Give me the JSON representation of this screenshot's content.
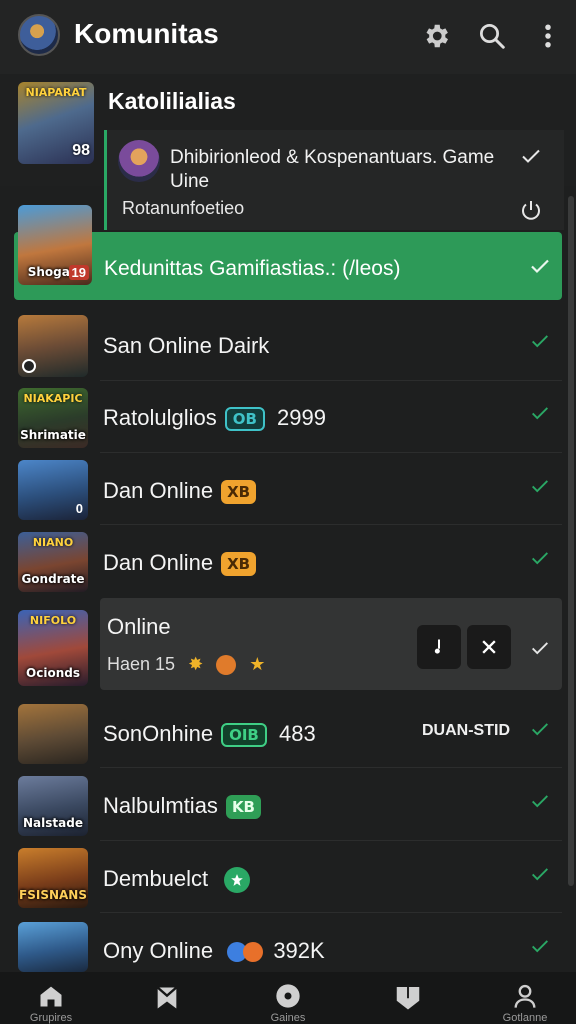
{
  "app": {
    "title": "Komunitas"
  },
  "toolbar": {
    "settings_icon": "gear-icon",
    "search_icon": "search-icon",
    "more_icon": "more-vert-icon"
  },
  "group": {
    "title": "Katolilialias",
    "thumb_top": "NIAPARAT",
    "thumb_badge": "98",
    "sub_item": {
      "title": "Dhibirionleod & Kospenantuars. Game Uine",
      "footer": "Rotanunfoetieo"
    }
  },
  "selected": {
    "title": "Kedunittas Gamifiastias.: (/leos)",
    "thumb_caption": "Shogam",
    "thumb_badge": "19"
  },
  "rows": [
    {
      "name": "San Online  Dairk",
      "thumb_caption": "",
      "badge": ""
    },
    {
      "name": "Ratolulglios",
      "thumb_top": "NIAKAPIC",
      "thumb_caption": "Shrimatie",
      "badge": "OB",
      "extra": "2999"
    },
    {
      "name": "Dan Online",
      "thumb_caption": "0",
      "badge": "XB"
    },
    {
      "name": "Dan Online",
      "thumb_top": "NIANO",
      "thumb_caption": "Gondrate",
      "badge": "XB"
    },
    {
      "name": "Online",
      "thumb_top": "NIFOLO",
      "thumb_caption": "Ocionds",
      "subline": "Haen 15"
    },
    {
      "name": "SonOnhine",
      "badge": "OIB",
      "extra": "483",
      "right_text": "DUAN-STID"
    },
    {
      "name": "Nalbulmtias",
      "thumb_caption": "Nalstade",
      "badge": "KB"
    },
    {
      "name": "Dembuelct",
      "thumb_caption": "FSISNANS"
    },
    {
      "name": "Ony Online",
      "extra": "392K"
    }
  ],
  "bottom_nav": [
    {
      "label": "Grupires",
      "icon": "home-icon"
    },
    {
      "label": "",
      "icon": "bookmark-icon"
    },
    {
      "label": "Gaines",
      "icon": "disc-icon"
    },
    {
      "label": "",
      "icon": "shield-icon"
    },
    {
      "label": "Gotlanne",
      "icon": "profile-icon"
    }
  ],
  "colors": {
    "accent": "#2d9a58",
    "background": "#1e1f1f",
    "check": "#2aa865"
  }
}
